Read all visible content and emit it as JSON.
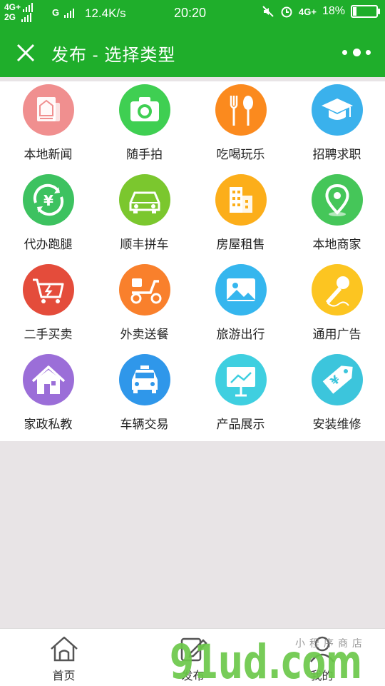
{
  "status_bar": {
    "network_top": "4G+",
    "network_bottom": "2G",
    "network_g": "G",
    "speed": "12.4K/s",
    "time": "20:20",
    "network_right": "4G+",
    "battery": "18%",
    "battery_level": 0.18
  },
  "title_bar": {
    "title": "发布 - 选择类型",
    "close_icon": "close-icon",
    "more_icon": "more-dots-icon"
  },
  "categories": [
    {
      "label": "本地新闻",
      "icon": "newspaper-icon",
      "color": "#f08f8f"
    },
    {
      "label": "随手拍",
      "icon": "camera-icon",
      "color": "#3fcf52"
    },
    {
      "label": "吃喝玩乐",
      "icon": "fork-spoon-icon",
      "color": "#fb8a1e"
    },
    {
      "label": "招聘求职",
      "icon": "graduation-cap-icon",
      "color": "#3ab1ec"
    },
    {
      "label": "代办跑腿",
      "icon": "yen-cycle-icon",
      "color": "#3dc260"
    },
    {
      "label": "顺丰拼车",
      "icon": "car-icon",
      "color": "#7bc72e"
    },
    {
      "label": "房屋租售",
      "icon": "building-icon",
      "color": "#fcae1a"
    },
    {
      "label": "本地商家",
      "icon": "location-pin-icon",
      "color": "#45c659"
    },
    {
      "label": "二手买卖",
      "icon": "shopping-cart-icon",
      "color": "#e44c3b"
    },
    {
      "label": "外卖送餐",
      "icon": "scooter-icon",
      "color": "#f9802c"
    },
    {
      "label": "旅游出行",
      "icon": "landscape-icon",
      "color": "#35b6ee"
    },
    {
      "label": "通用广告",
      "icon": "microphone-icon",
      "color": "#fcc521"
    },
    {
      "label": "家政私教",
      "icon": "house-icon",
      "color": "#9b6ed8"
    },
    {
      "label": "车辆交易",
      "icon": "taxi-icon",
      "color": "#2f97ea"
    },
    {
      "label": "产品展示",
      "icon": "presentation-board-icon",
      "color": "#3fcfe0"
    },
    {
      "label": "安装维修",
      "icon": "price-tag-icon",
      "color": "#3cc5dc"
    }
  ],
  "bottom_nav": [
    {
      "label": "首页",
      "icon": "home-icon"
    },
    {
      "label": "发布",
      "icon": "edit-icon",
      "active": true
    },
    {
      "label": "我的",
      "icon": "user-icon"
    }
  ],
  "watermark": {
    "brand": "91ud.com",
    "small_text": "小程序商店"
  },
  "colors": {
    "header": "#1fae2b",
    "background": "#e8e4e6",
    "watermark_green": "#6cc84a",
    "watermark_orange": "#ffa12c"
  }
}
